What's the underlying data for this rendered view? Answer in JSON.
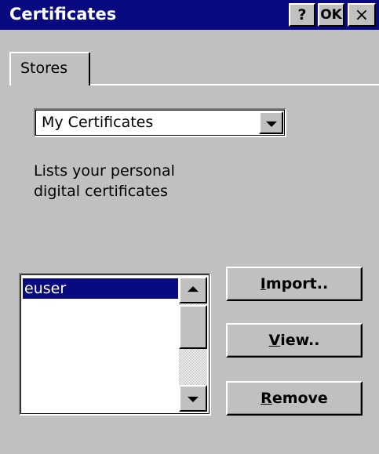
{
  "window": {
    "title": "Certificates",
    "help_label": "?",
    "ok_label": "OK",
    "close_label": "×"
  },
  "tabs": [
    {
      "label": "Stores",
      "selected": true
    }
  ],
  "store_select": {
    "value": "My Certificates"
  },
  "description_line1": "Lists your personal",
  "description_line2": "digital certificates",
  "certificate_list": {
    "items": [
      {
        "label": "euser",
        "selected": true
      }
    ]
  },
  "buttons": {
    "import": {
      "hotkey": "I",
      "rest": "mport.."
    },
    "view": {
      "hotkey": "V",
      "rest": "iew.."
    },
    "remove": {
      "hotkey": "R",
      "rest": "emove"
    }
  },
  "colors": {
    "title_bar": "#0a0a80",
    "face": "#c0c0c0",
    "selection": "#0a0a80"
  }
}
